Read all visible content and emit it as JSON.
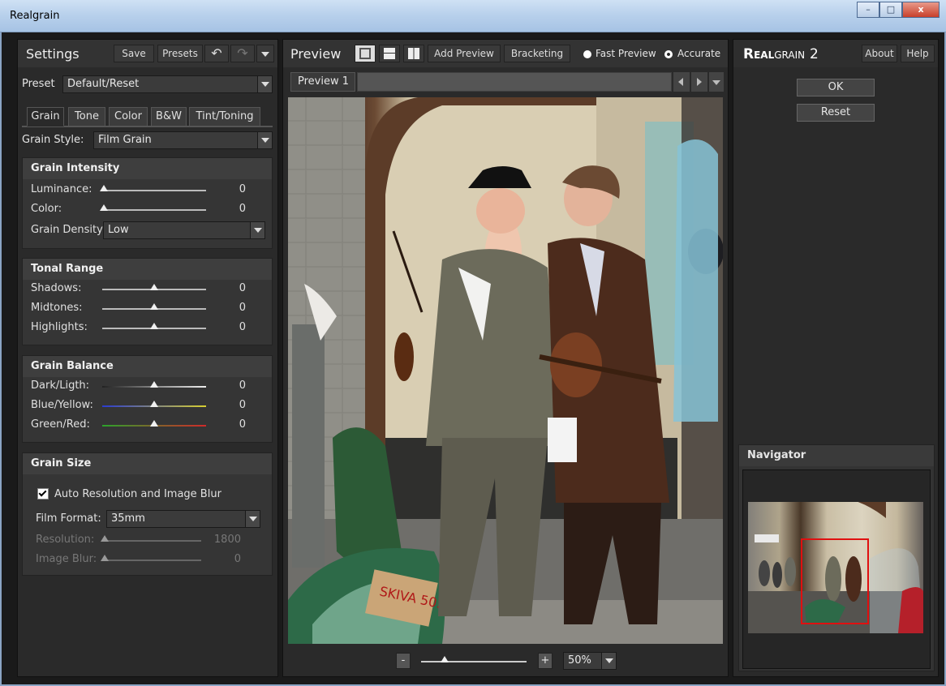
{
  "window": {
    "title": "Realgrain",
    "min": "–",
    "max": "□",
    "close": "x"
  },
  "settings": {
    "title": "Settings",
    "save": "Save",
    "presets": "Presets",
    "undo": "↶",
    "redo": "↷",
    "preset_label": "Preset",
    "preset_value": "Default/Reset",
    "tabs": [
      "Grain",
      "Tone",
      "Color",
      "B&W",
      "Tint/Toning"
    ],
    "grain_style_label": "Grain Style:",
    "grain_style_value": "Film Grain",
    "grain_intensity": {
      "title": "Grain Intensity",
      "luminance_label": "Luminance:",
      "luminance_value": "0",
      "color_label": "Color:",
      "color_value": "0",
      "density_label": "Grain Density",
      "density_value": "Low"
    },
    "tonal_range": {
      "title": "Tonal Range",
      "shadows_label": "Shadows:",
      "shadows_value": "0",
      "midtones_label": "Midtones:",
      "midtones_value": "0",
      "highlights_label": "Highlights:",
      "highlights_value": "0"
    },
    "grain_balance": {
      "title": "Grain Balance",
      "dark_label": "Dark/Ligth:",
      "dark_value": "0",
      "blue_label": "Blue/Yellow:",
      "blue_value": "0",
      "green_label": "Green/Red:",
      "green_value": "0"
    },
    "grain_size": {
      "title": "Grain Size",
      "auto_label": "Auto Resolution and Image Blur",
      "film_format_label": "Film Format:",
      "film_format_value": "35mm",
      "resolution_label": "Resolution:",
      "resolution_value": "1800",
      "blur_label": "Image Blur:",
      "blur_value": "0"
    }
  },
  "preview": {
    "title": "Preview",
    "add_preview": "Add Preview",
    "bracketing": "Bracketing",
    "fast_preview": "Fast Preview",
    "accurate": "Accurate",
    "tab": "Preview 1",
    "zoom_minus": "-",
    "zoom_plus": "+",
    "zoom_value": "50%",
    "sign_text": "SKIVA 50:-"
  },
  "right": {
    "brand_real": "Real",
    "brand_grain": "grain",
    "brand_version": "2",
    "about": "About",
    "help": "Help",
    "ok": "OK",
    "reset": "Reset",
    "navigator_title": "Navigator"
  }
}
